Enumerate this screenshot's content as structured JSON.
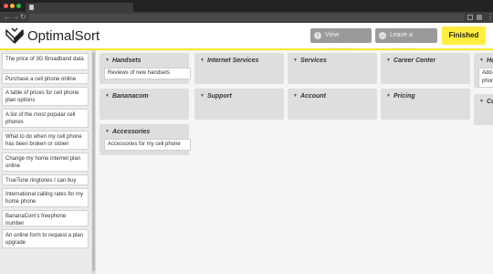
{
  "header": {
    "brand": "OptimalSort",
    "view_instructions": "View instructions",
    "leave_comment": "Leave a comment",
    "finished": "Finished"
  },
  "cards": [
    "The price of 3G Broadband data",
    "Purchase a cell phone online",
    "A table of prices for cell phone plan options",
    "A list of the most popular cell phones",
    "What to do when my cell phone has been broken or stolen",
    "Change my home internet plan online",
    "TrueTone ringtones I can buy",
    "International calling rates for my home phone",
    "BananaCom's freephone number",
    "An online form to request a plan upgrade"
  ],
  "groups": [
    {
      "title": "Handsets",
      "cards": [
        "Reviews of new handsets"
      ]
    },
    {
      "title": "Internet Services",
      "cards": []
    },
    {
      "title": "Services",
      "cards": []
    },
    {
      "title": "Career Center",
      "cards": []
    },
    {
      "title": "Ho",
      "cards": [
        "Add-...",
        "phon..."
      ]
    },
    {
      "title": "Bananacom",
      "cards": []
    },
    {
      "title": "Support",
      "cards": []
    },
    {
      "title": "Account",
      "cards": []
    },
    {
      "title": "Pricing",
      "cards": []
    },
    {
      "title": "Co",
      "cards": []
    },
    {
      "title": "Accessories",
      "cards": [
        "Accessories for my cell phone"
      ]
    }
  ],
  "colors": {
    "accent": "#ffee3d",
    "button_gray": "#9a9a9a"
  }
}
